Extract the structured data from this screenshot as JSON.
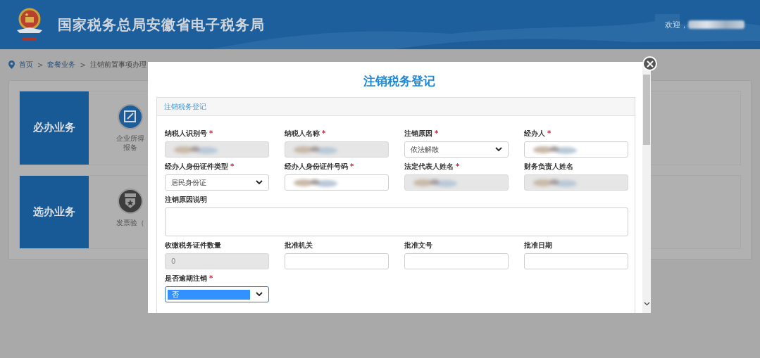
{
  "header": {
    "title": "国家税务总局安徽省电子税务局",
    "welcome": "欢迎，"
  },
  "breadcrumb": {
    "items": [
      {
        "label": "首页",
        "link": true
      },
      {
        "label": "套餐业务",
        "link": true
      },
      {
        "label": "注销前置事项办理",
        "link": false
      }
    ],
    "separators": [
      ">",
      ">"
    ]
  },
  "groups": [
    {
      "title": "必办业务",
      "items": [
        {
          "label_lines": [
            "企业所得",
            "报备"
          ]
        }
      ]
    },
    {
      "title": "选办业务",
      "items": [
        {
          "label_lines": [
            "发票验（"
          ]
        }
      ]
    }
  ],
  "modal": {
    "title": "注销税务登记",
    "section_title": "注销税务登记",
    "fields": [
      {
        "kind": "input",
        "label": "纳税人识别号",
        "required_mark": "*",
        "disabled": true,
        "redacted": true
      },
      {
        "kind": "input",
        "label": "纳税人名称",
        "required_mark": "*",
        "disabled": true,
        "redacted": true
      },
      {
        "kind": "select",
        "label": "注销原因",
        "required_mark": "*",
        "disabled": false,
        "value": "依法解散"
      },
      {
        "kind": "input",
        "label": "经办人",
        "required_mark": "*",
        "disabled": false,
        "redacted": true
      },
      {
        "kind": "select",
        "label": "经办人身份证件类型",
        "required_mark": "*",
        "disabled": false,
        "value": "居民身份证"
      },
      {
        "kind": "input",
        "label": "经办人身份证件号码",
        "required_mark": "*",
        "disabled": false,
        "redacted": true
      },
      {
        "kind": "input",
        "label": "法定代表人姓名",
        "required_mark": "*",
        "disabled": true,
        "redacted": true
      },
      {
        "kind": "input",
        "label": "财务负责人姓名",
        "disabled": true,
        "redacted": true
      },
      {
        "kind": "textarea",
        "label": "注销原因说明",
        "disabled": false
      },
      {
        "kind": "input",
        "label": "收缴税务证件数量",
        "disabled": true,
        "value": "0"
      },
      {
        "kind": "input",
        "label": "批准机关",
        "disabled": false
      },
      {
        "kind": "input",
        "label": "批准文号",
        "disabled": false
      },
      {
        "kind": "input",
        "label": "批准日期",
        "disabled": false
      },
      {
        "kind": "select",
        "label": "是否逾期注销",
        "required_mark": "*",
        "disabled": false,
        "value": "否",
        "selected": true
      }
    ]
  }
}
